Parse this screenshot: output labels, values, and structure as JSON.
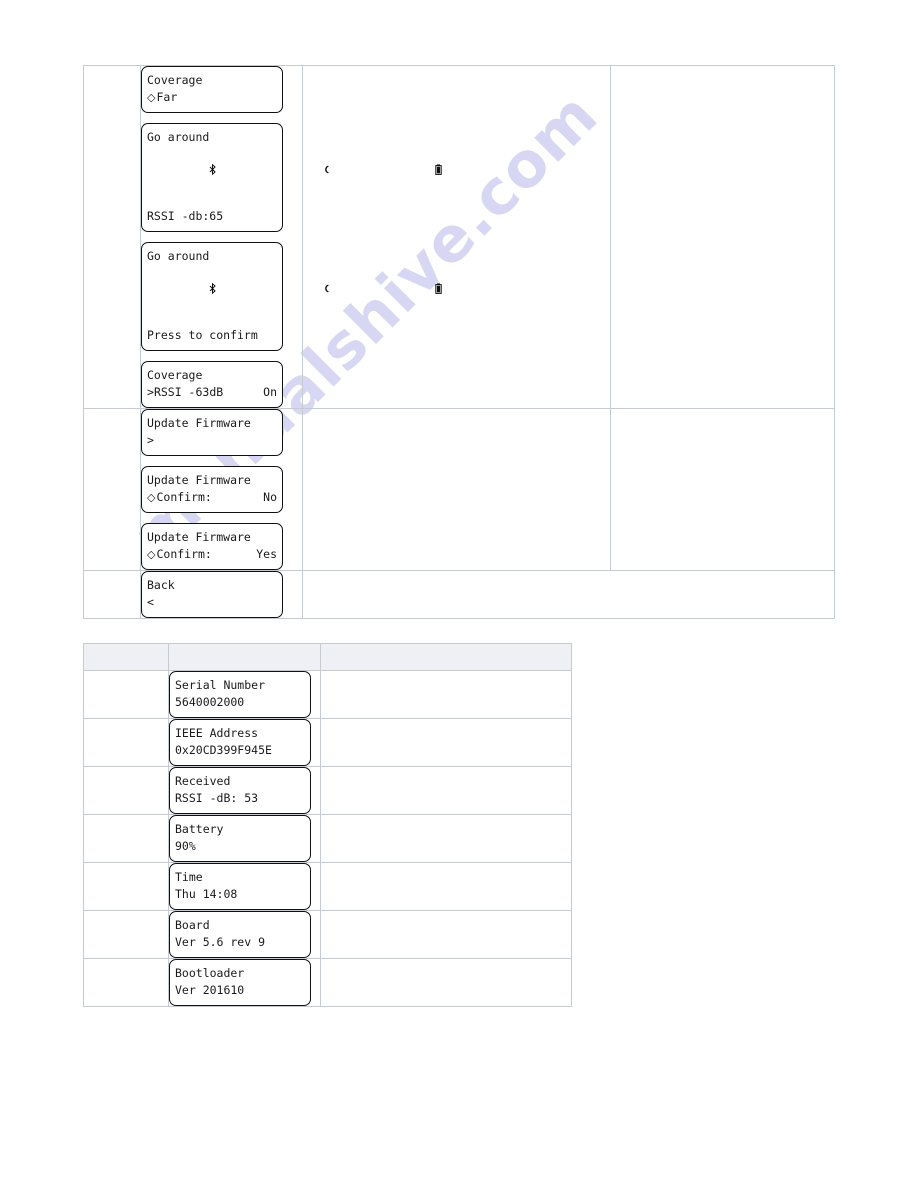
{
  "page": {
    "watermark": "manualshive.com",
    "accent_gray_header": "#eff0f3",
    "border_color": "#c6cad1",
    "lcd_border_color": "#111111"
  },
  "table_one": {
    "rows": [
      {
        "screens": [
          {
            "line1": "Coverage",
            "prefix": "◇",
            "line2": "Far",
            "right": "",
            "icons": false
          },
          {
            "line1": "Go around",
            "prefix": "",
            "line2": "RSSI -db:65",
            "right": "",
            "icons": true
          },
          {
            "line1": "Go around",
            "prefix": "",
            "line2": "Press to confirm",
            "right": "",
            "icons": true
          },
          {
            "line1": "Coverage",
            "prefix": ">",
            "line2": "RSSI -63dB",
            "right": "On",
            "icons": false
          }
        ]
      },
      {
        "screens": [
          {
            "line1": "Update Firmware",
            "prefix": ">",
            "line2": "",
            "right": "",
            "icons": false
          },
          {
            "line1": "Update Firmware",
            "prefix": "◇",
            "line2": "Confirm:",
            "right": "No",
            "icons": false
          },
          {
            "line1": "Update Firmware",
            "prefix": "◇",
            "line2": "Confirm:",
            "right": "Yes",
            "icons": false
          }
        ]
      },
      {
        "screens": [
          {
            "line1": "Back",
            "prefix": "<",
            "line2": "",
            "right": "",
            "icons": false
          }
        ]
      }
    ]
  },
  "table_two": {
    "header": {
      "col1": "",
      "col2": "",
      "col3": ""
    },
    "rows": [
      {
        "line1": "Serial Number",
        "line2": "5640002000"
      },
      {
        "line1": "IEEE Address",
        "line2": "0x20CD399F945E"
      },
      {
        "line1": "Received",
        "line2": "RSSI -dB: 53"
      },
      {
        "line1": "Battery",
        "line2": "90%"
      },
      {
        "line1": "Time",
        "line2": "Thu 14:08"
      },
      {
        "line1": "Board",
        "line2": "Ver 5.6 rev 9"
      },
      {
        "line1": "Bootloader",
        "line2": "Ver 201610"
      }
    ]
  },
  "icons": {
    "bluetooth": "bluetooth-icon",
    "signal": "signal-icon",
    "battery": "battery-icon"
  }
}
